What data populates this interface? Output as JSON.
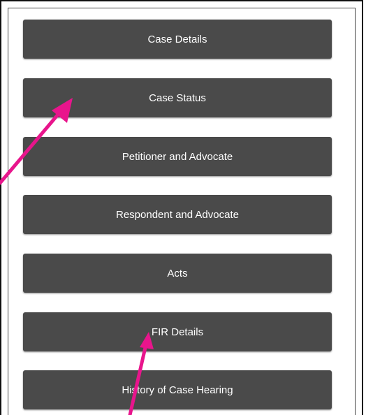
{
  "menu": {
    "items": [
      {
        "label": "Case Details"
      },
      {
        "label": "Case Status"
      },
      {
        "label": "Petitioner and Advocate"
      },
      {
        "label": "Respondent and Advocate"
      },
      {
        "label": "Acts"
      },
      {
        "label": "FIR Details"
      },
      {
        "label": "History of Case Hearing"
      }
    ]
  },
  "colors": {
    "button_bg": "#4a4a4a",
    "button_text": "#ffffff",
    "arrow": "#e8158c"
  },
  "annotations": [
    {
      "icon": "arrow-icon",
      "points_to": "Case Status"
    },
    {
      "icon": "arrow-icon",
      "points_to": "FIR Details"
    }
  ]
}
